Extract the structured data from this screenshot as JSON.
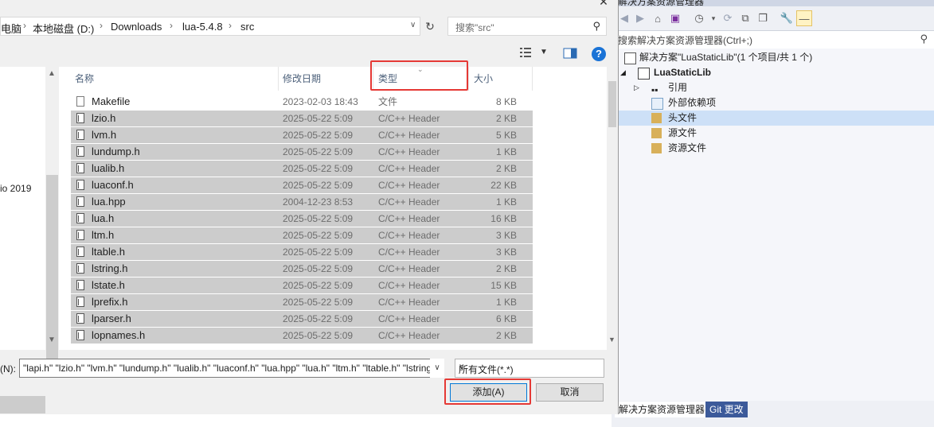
{
  "dialog": {
    "breadcrumb": [
      "电脑",
      "本地磁盘 (D:)",
      "Downloads",
      "lua-5.4.8",
      "src"
    ],
    "search_placeholder": "搜索\"src\"",
    "nav_item_partial": "io 2019",
    "columns": {
      "name": "名称",
      "date": "修改日期",
      "type": "类型",
      "size": "大小"
    },
    "files": [
      {
        "name": "Makefile",
        "date": "2023-02-03 18:43",
        "type": "文件",
        "size": "8 KB",
        "selected": false,
        "icon": "file-icon"
      },
      {
        "name": "lzio.h",
        "date": "2025-05-22 5:09",
        "type": "C/C++ Header",
        "size": "2 KB",
        "selected": true,
        "icon": "header-file-icon"
      },
      {
        "name": "lvm.h",
        "date": "2025-05-22 5:09",
        "type": "C/C++ Header",
        "size": "5 KB",
        "selected": true,
        "icon": "header-file-icon"
      },
      {
        "name": "lundump.h",
        "date": "2025-05-22 5:09",
        "type": "C/C++ Header",
        "size": "1 KB",
        "selected": true,
        "icon": "header-file-icon"
      },
      {
        "name": "lualib.h",
        "date": "2025-05-22 5:09",
        "type": "C/C++ Header",
        "size": "2 KB",
        "selected": true,
        "icon": "header-file-icon"
      },
      {
        "name": "luaconf.h",
        "date": "2025-05-22 5:09",
        "type": "C/C++ Header",
        "size": "22 KB",
        "selected": true,
        "icon": "header-file-icon"
      },
      {
        "name": "lua.hpp",
        "date": "2004-12-23 8:53",
        "type": "C/C++ Header",
        "size": "1 KB",
        "selected": true,
        "icon": "header-file-icon"
      },
      {
        "name": "lua.h",
        "date": "2025-05-22 5:09",
        "type": "C/C++ Header",
        "size": "16 KB",
        "selected": true,
        "icon": "header-file-icon"
      },
      {
        "name": "ltm.h",
        "date": "2025-05-22 5:09",
        "type": "C/C++ Header",
        "size": "3 KB",
        "selected": true,
        "icon": "header-file-icon"
      },
      {
        "name": "ltable.h",
        "date": "2025-05-22 5:09",
        "type": "C/C++ Header",
        "size": "3 KB",
        "selected": true,
        "icon": "header-file-icon"
      },
      {
        "name": "lstring.h",
        "date": "2025-05-22 5:09",
        "type": "C/C++ Header",
        "size": "2 KB",
        "selected": true,
        "icon": "header-file-icon"
      },
      {
        "name": "lstate.h",
        "date": "2025-05-22 5:09",
        "type": "C/C++ Header",
        "size": "15 KB",
        "selected": true,
        "icon": "header-file-icon"
      },
      {
        "name": "lprefix.h",
        "date": "2025-05-22 5:09",
        "type": "C/C++ Header",
        "size": "1 KB",
        "selected": true,
        "icon": "header-file-icon"
      },
      {
        "name": "lparser.h",
        "date": "2025-05-22 5:09",
        "type": "C/C++ Header",
        "size": "6 KB",
        "selected": true,
        "icon": "header-file-icon"
      },
      {
        "name": "lopnames.h",
        "date": "2025-05-22 5:09",
        "type": "C/C++ Header",
        "size": "2 KB",
        "selected": true,
        "icon": "header-file-icon"
      }
    ],
    "filename_label": "(N):",
    "filename_value": "\"lapi.h\" \"lzio.h\" \"lvm.h\" \"lundump.h\" \"lualib.h\" \"luaconf.h\" \"lua.hpp\" \"lua.h\" \"ltm.h\" \"ltable.h\" \"lstring.h\" \"lstate.h\"",
    "file_type_filter": "所有文件(*.*)",
    "add_button": "添加(A)",
    "cancel_button": "取消",
    "highlight_color": "#e53935",
    "selection_color": "#cccccc"
  },
  "solution_explorer": {
    "title_partial": "解决方案资源管理器",
    "search_placeholder": "搜索解决方案资源管理器(Ctrl+;)",
    "tree": [
      {
        "label": "解决方案\"LuaStaticLib\"(1 个项目/共 1 个)",
        "icon": "solution-icon",
        "level": 0,
        "bold": false
      },
      {
        "label": "LuaStaticLib",
        "icon": "project-icon",
        "level": 0,
        "bold": true,
        "expanded": true
      },
      {
        "label": "引用",
        "icon": "references-icon",
        "level": 1,
        "bold": false
      },
      {
        "label": "外部依赖项",
        "icon": "external-deps-icon",
        "level": 1,
        "bold": false
      },
      {
        "label": "头文件",
        "icon": "filter-folder-icon",
        "level": 1,
        "bold": false,
        "selected": true
      },
      {
        "label": "源文件",
        "icon": "filter-folder-icon",
        "level": 1,
        "bold": false
      },
      {
        "label": "资源文件",
        "icon": "filter-folder-icon",
        "level": 1,
        "bold": false
      }
    ],
    "tabs": [
      "解决方案资源管理器",
      "Git 更改"
    ],
    "active_tab_color": "#ffffff",
    "inactive_tab_color": "#3c5a9a"
  }
}
